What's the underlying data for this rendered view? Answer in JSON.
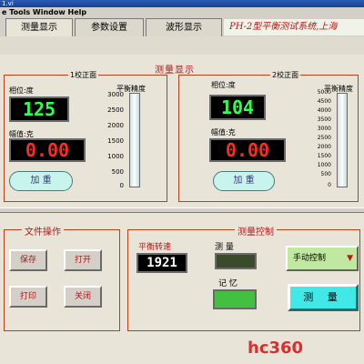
{
  "window": {
    "title": "1.vi"
  },
  "menubar": {
    "items_text": "e Tools Window Help"
  },
  "tabs": [
    {
      "label": "测量显示"
    },
    {
      "label": "参数设置"
    },
    {
      "label": "波形显示"
    }
  ],
  "banner": "PH-2型平衡测试系统,上海",
  "measure_panel": {
    "title": "测量显示",
    "left": {
      "group_label": "1校正面",
      "phase_label": "相位:度",
      "phase_value": "125",
      "amp_label": "幅值:克",
      "amp_value": "0.00",
      "add_button": "加  重",
      "gauge_label": "平衡精度",
      "gauge_ticks": [
        "3000",
        "2500",
        "2000",
        "1500",
        "1000",
        "500",
        "0"
      ]
    },
    "right": {
      "group_label": "2校正面",
      "phase_label": "相位:度",
      "phase_value": "104",
      "amp_label": "幅值:克",
      "amp_value": "0.00",
      "add_button": "加  重",
      "gauge_label": "平衡精度",
      "gauge_ticks": [
        "5000",
        "4500",
        "4000",
        "3500",
        "3000",
        "2500",
        "2000",
        "1500",
        "1000",
        "500",
        "0"
      ]
    }
  },
  "file_ops": {
    "title": "文件操作",
    "buttons": [
      "保存",
      "打开",
      "打印",
      "关闭"
    ]
  },
  "measure_control": {
    "title": "测量控制",
    "speed_label": "平衡转速",
    "speed_value": "1921",
    "measure_label": "测  量",
    "record_label": "记  忆",
    "manual_button": "手动控制",
    "manual_arrow": "▼",
    "measure_button": "测  量"
  },
  "watermark_bottom": "hc360",
  "colors": {
    "accent_red": "#b01818",
    "display_green": "#30ff50",
    "display_red": "#ff2a20",
    "button_cyan": "#40e8e8",
    "manual_green": "#c0e8a0"
  }
}
